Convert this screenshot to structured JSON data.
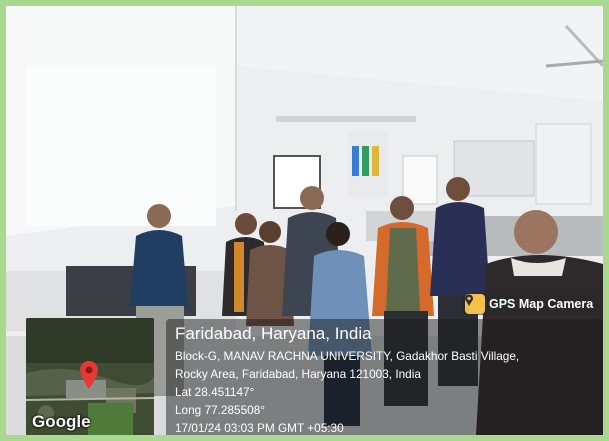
{
  "badge": {
    "label": "GPS Map Camera",
    "icon": "map-pin-icon"
  },
  "map": {
    "logo": "Google",
    "pin_color": "#e53935"
  },
  "location": {
    "title": "Faridabad, Haryana, India",
    "address_line1": "Block-G, MANAV RACHNA UNIVERSITY, Gadakhor Basti Village,",
    "address_line2": "Rocky Area, Faridabad, Haryana 121003, India",
    "lat": "Lat 28.451147°",
    "long": "Long 77.285508°",
    "datetime": "17/01/24 03:03 PM GMT +05:30"
  },
  "colors": {
    "frame": "#a8d98f",
    "overlay": "rgba(25,25,25,0.48)"
  }
}
